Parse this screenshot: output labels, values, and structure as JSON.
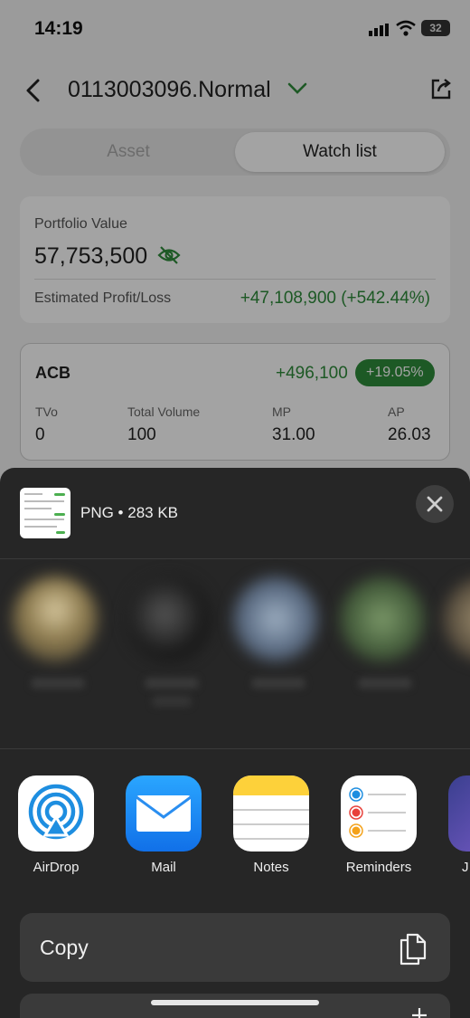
{
  "status_bar": {
    "time": "14:19",
    "battery": "32",
    "icons": [
      "signal-icon",
      "wifi-icon",
      "battery-icon"
    ]
  },
  "header": {
    "title": "0113003096.Normal",
    "back_icon": "chevron-left-icon",
    "dropdown_icon": "chevron-down-icon",
    "share_icon": "share-icon"
  },
  "tabs": [
    {
      "label": "Asset",
      "selected": false
    },
    {
      "label": "Watch list",
      "selected": true
    }
  ],
  "portfolio": {
    "label": "Portfolio Value",
    "value": "57,753,500",
    "visibility_icon": "eye-hidden-icon",
    "profit_label": "Estimated Profit/Loss",
    "profit_value": "+47,108,900 (+542.44%)"
  },
  "stock": {
    "symbol": "ACB",
    "change": "+496,100",
    "change_pct": "+19.05%",
    "columns": [
      {
        "header": "TVo",
        "value": "0"
      },
      {
        "header": "Total Volume",
        "value": "100"
      },
      {
        "header": "MP",
        "value": "31.00"
      },
      {
        "header": "AP",
        "value": "26.03"
      }
    ]
  },
  "share_sheet": {
    "file_info": "PNG • 283 KB",
    "close_icon": "close-icon",
    "apps": [
      {
        "label": "AirDrop",
        "icon": "airdrop-icon"
      },
      {
        "label": "Mail",
        "icon": "mail-icon"
      },
      {
        "label": "Notes",
        "icon": "notes-icon"
      },
      {
        "label": "Reminders",
        "icon": "reminders-icon"
      },
      {
        "label": "J",
        "icon": "app-icon"
      }
    ],
    "actions": [
      {
        "label": "Copy",
        "icon": "copy-icon"
      }
    ]
  },
  "colors": {
    "accent_green": "#2e8b3a",
    "sheet_bg": "#262626",
    "action_bg": "#3a3a3a"
  }
}
